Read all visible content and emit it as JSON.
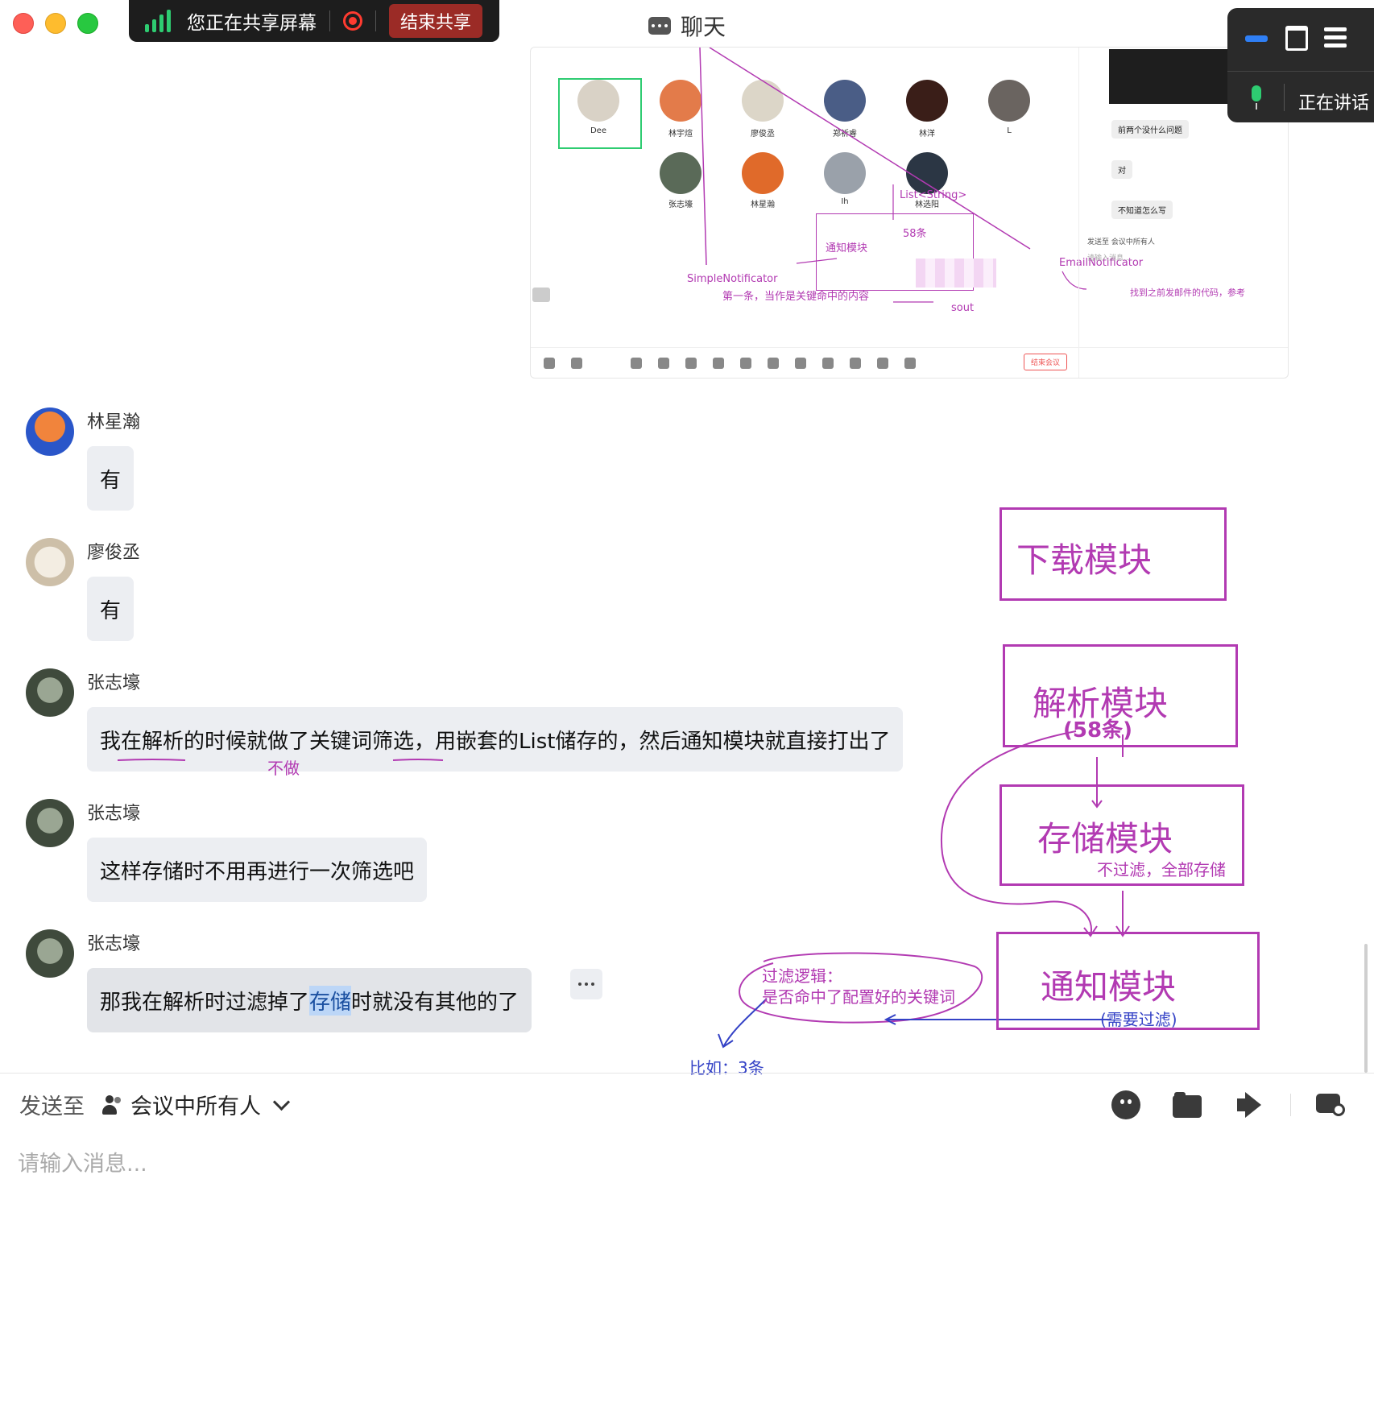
{
  "window": {
    "title": "聊天"
  },
  "share_bar": {
    "status_text": "您正在共享屏幕",
    "stop_button": "结束共享"
  },
  "floating_panel": {
    "speaking_label": "正在讲话"
  },
  "shared_screen": {
    "participants": [
      {
        "name": "Dee"
      },
      {
        "name": "林宇煊"
      },
      {
        "name": "廖俊丞"
      },
      {
        "name": "郑祈睿"
      },
      {
        "name": "林洋"
      },
      {
        "name": "L"
      },
      {
        "name": "张志壕"
      },
      {
        "name": "林星瀚"
      },
      {
        "name": "Ih"
      },
      {
        "name": "林选阳"
      }
    ],
    "side_chat_messages": [
      "前两个没什么问题",
      "对",
      "不知道怎么写"
    ],
    "side_send_to": "发送至 会议中所有人",
    "side_input_placeholder": "请输入消息...",
    "end_meeting_button": "结束会议",
    "annotations": {
      "list_type": "List<String>",
      "count": "58条",
      "notify_module": "通知模块",
      "simple_notificator": "SimpleNotificator",
      "first_note": "第一条，当作是关键命中的内容",
      "sout": "sout",
      "email_notificator": "EmailNotificator",
      "email_note": "找到之前发邮件的代码，参考"
    }
  },
  "messages": [
    {
      "sender": "林星瀚",
      "text": "有"
    },
    {
      "sender": "廖俊丞",
      "text": "有"
    },
    {
      "sender": "张志壕",
      "text": "我在解析的时候就做了关键词筛选，用嵌套的List储存的，然后通知模块就直接打出了"
    },
    {
      "sender": "张志壕",
      "text": "这样存储时不用再进行一次筛选吧"
    },
    {
      "sender": "张志壕",
      "text_before": "那我在解析时过滤掉了",
      "text_highlight": "存储",
      "text_after": "时就没有其他的了"
    }
  ],
  "annotations": {
    "not_do": "不做",
    "download_module": "下载模块",
    "parse_module": "解析模块",
    "parse_count": "(58条)",
    "storage_module": "存储模块",
    "storage_note": "不过滤，全部存储",
    "notify_module": "通知模块",
    "notify_note": "(需要过滤)",
    "filter_title": "过滤逻辑：",
    "filter_text": "是否命中了配置好的关键词",
    "example": "比如：3条"
  },
  "composer": {
    "send_to_label": "发送至",
    "recipient": "会议中所有人",
    "placeholder": "请输入消息..."
  },
  "colors": {
    "annotation_purple": "#b23ab2",
    "annotation_blue": "#3442c6",
    "bubble_bg": "#eceef2",
    "stop_share_red": "#9b2b26"
  }
}
